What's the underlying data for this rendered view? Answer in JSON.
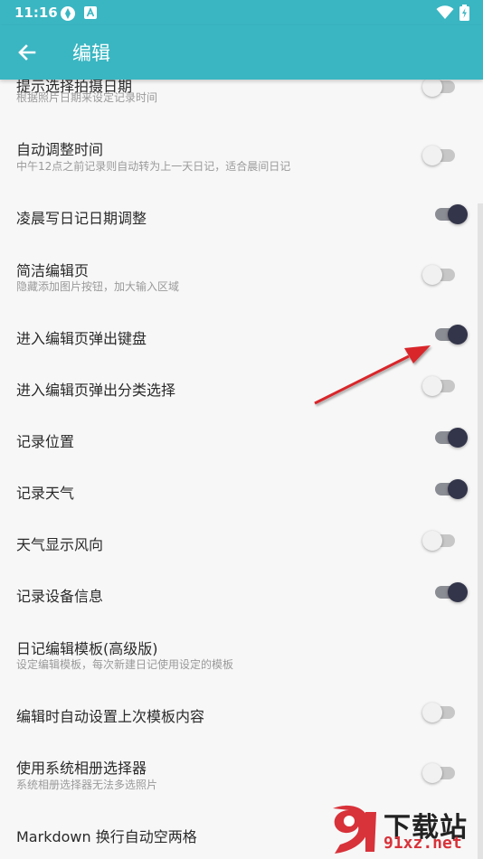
{
  "status_bar": {
    "time": "11:16",
    "icons": [
      "vpn-icon",
      "a-badge-icon",
      "wifi-icon",
      "battery-icon"
    ]
  },
  "app_bar": {
    "title": "编辑",
    "back_icon": "arrow-left-icon"
  },
  "settings": [
    {
      "title": "提示选择拍摄日期",
      "subtitle": "根据照片日期来设定记录时间",
      "toggle": false
    },
    {
      "title": "自动调整时间",
      "subtitle": "中午12点之前记录则自动转为上一天日记，适合晨间日记",
      "toggle": false
    },
    {
      "title": "凌晨写日记日期调整",
      "subtitle": "",
      "toggle": true
    },
    {
      "title": "简洁编辑页",
      "subtitle": "隐藏添加图片按钮，加大输入区域",
      "toggle": false
    },
    {
      "title": "进入编辑页弹出键盘",
      "subtitle": "",
      "toggle": true
    },
    {
      "title": "进入编辑页弹出分类选择",
      "subtitle": "",
      "toggle": false
    },
    {
      "title": "记录位置",
      "subtitle": "",
      "toggle": true
    },
    {
      "title": "记录天气",
      "subtitle": "",
      "toggle": true
    },
    {
      "title": "天气显示风向",
      "subtitle": "",
      "toggle": false
    },
    {
      "title": "记录设备信息",
      "subtitle": "",
      "toggle": true
    },
    {
      "title": "日记编辑模板(高级版)",
      "subtitle": "设定编辑模板，每次新建日记使用设定的模板",
      "toggle": null
    },
    {
      "title": "编辑时自动设置上次模板内容",
      "subtitle": "",
      "toggle": false
    },
    {
      "title": "使用系统相册选择器",
      "subtitle": "系统相册选择器无法多选照片",
      "toggle": false
    },
    {
      "title": "Markdown 换行自动空两格",
      "subtitle": "",
      "toggle": null
    }
  ],
  "watermark": {
    "text": "下载站",
    "url": "91xz.net"
  },
  "colors": {
    "accent": "#3ab6c2",
    "toggle_on": "#33354a",
    "toggle_off": "#f1f1f1",
    "arrow": "#d8262c"
  }
}
